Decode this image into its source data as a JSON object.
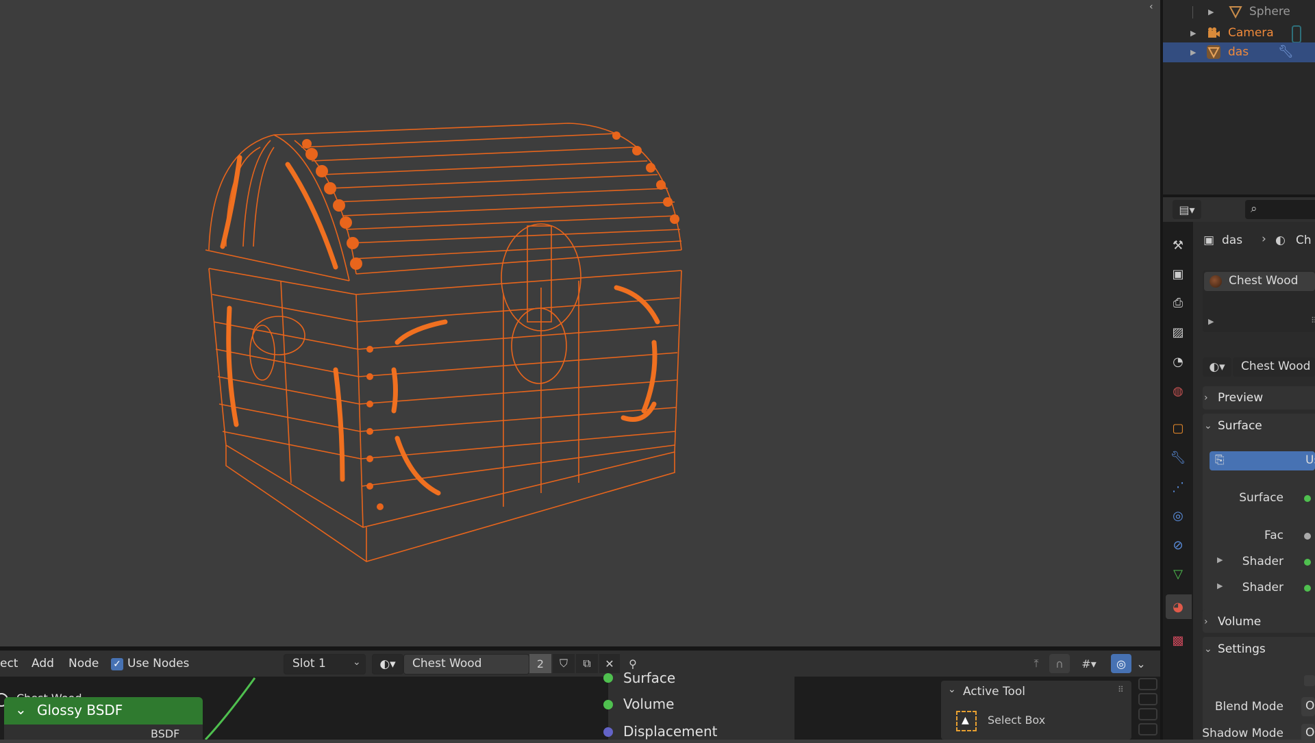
{
  "outliner": {
    "items": [
      {
        "label": "Sphere",
        "icon": "mesh-icon",
        "color": "#9a9a9a"
      },
      {
        "label": "Camera",
        "icon": "camera-icon",
        "color": "#f08a3a"
      },
      {
        "label": "das",
        "icon": "mesh-icon",
        "color": "#f08a3a"
      }
    ]
  },
  "properties": {
    "breadcrumb": {
      "object": "das",
      "material": "Ch"
    },
    "material_slot": "Chest Wood",
    "material_name": "Chest Wood",
    "panels": {
      "preview": "Preview",
      "surface": "Surface",
      "use_nodes": "Us",
      "volume": "Volume",
      "settings": "Settings"
    },
    "surface_rows": {
      "surface": "Surface",
      "fac": "Fac",
      "shader1": "Shader",
      "shader2": "Shader"
    },
    "settings_rows": {
      "blend_mode": "Blend Mode",
      "shadow_mode": "Shadow Mode",
      "blend_mode_value": "O",
      "shadow_mode_value": "O"
    }
  },
  "node_editor": {
    "menu": {
      "select": "ect",
      "add": "Add",
      "node": "Node"
    },
    "use_nodes_label": "Use Nodes",
    "use_nodes_checked": true,
    "slot": "Slot 1",
    "material": "Chest Wood",
    "users": "2",
    "nodes": {
      "frame_label": "Chest Wood",
      "glossy": "Glossy BSDF",
      "bsdf_out": "BSDF",
      "out_surface": "Surface",
      "out_volume": "Volume",
      "out_displacement": "Displacement"
    },
    "active_tool": {
      "title": "Active Tool",
      "tool": "Select Box"
    }
  },
  "colors": {
    "selection": "#334d80",
    "wire": "#e8651c",
    "node_green": "#2f7a2f",
    "accent_blue": "#4772b3"
  }
}
